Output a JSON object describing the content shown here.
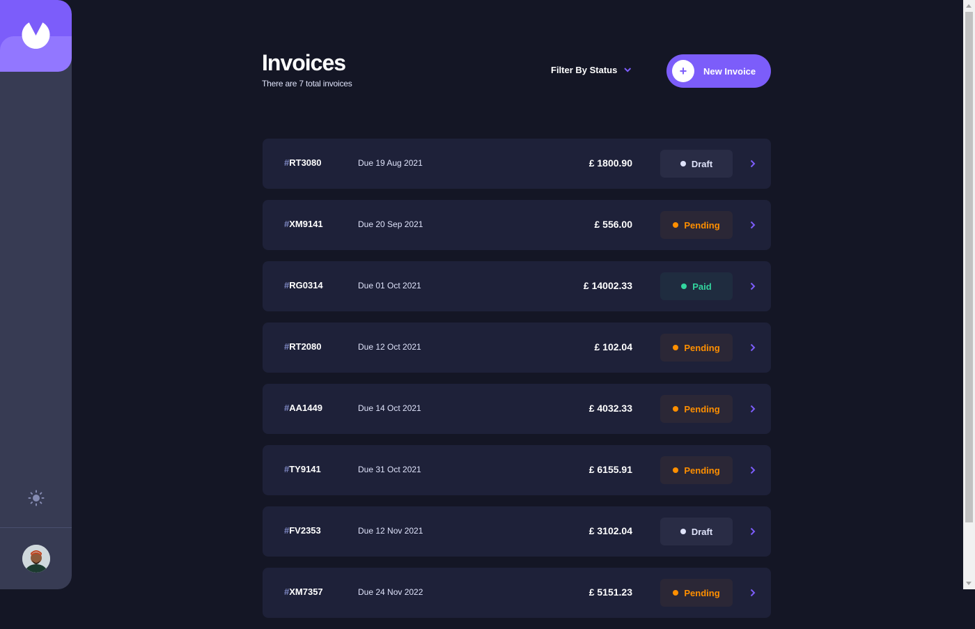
{
  "colors": {
    "accent": "#7c5dfa",
    "accent_light": "#9277ff",
    "background": "#141625",
    "card": "#1e2139",
    "sidebar": "#373b53",
    "paid": "#33d69f",
    "pending": "#ff8f00",
    "draft": "#dfe3fa"
  },
  "sidebar": {
    "logo_icon": "logo-icon",
    "theme_icon": "sun-icon",
    "avatar_icon": "avatar"
  },
  "header": {
    "title": "Invoices",
    "subtitle": "There are 7 total invoices",
    "filter_label": "Filter By Status",
    "filter_icon": "chevron-down-icon",
    "new_button_label": "New Invoice",
    "new_button_icon": "+"
  },
  "invoices": [
    {
      "hash": "#",
      "id": "RT3080",
      "due": "Due 19 Aug 2021",
      "client": "",
      "amount": "£ 1800.90",
      "status": "Draft",
      "status_class": "draft"
    },
    {
      "hash": "#",
      "id": "XM9141",
      "due": "Due 20 Sep 2021",
      "client": "",
      "amount": "£ 556.00",
      "status": "Pending",
      "status_class": "pending"
    },
    {
      "hash": "#",
      "id": "RG0314",
      "due": "Due 01 Oct 2021",
      "client": "",
      "amount": "£ 14002.33",
      "status": "Paid",
      "status_class": "paid"
    },
    {
      "hash": "#",
      "id": "RT2080",
      "due": "Due 12 Oct 2021",
      "client": "",
      "amount": "£ 102.04",
      "status": "Pending",
      "status_class": "pending"
    },
    {
      "hash": "#",
      "id": "AA1449",
      "due": "Due 14 Oct 2021",
      "client": "",
      "amount": "£ 4032.33",
      "status": "Pending",
      "status_class": "pending"
    },
    {
      "hash": "#",
      "id": "TY9141",
      "due": "Due 31 Oct 2021",
      "client": "",
      "amount": "£ 6155.91",
      "status": "Pending",
      "status_class": "pending"
    },
    {
      "hash": "#",
      "id": "FV2353",
      "due": "Due 12 Nov 2021",
      "client": "",
      "amount": "£ 3102.04",
      "status": "Draft",
      "status_class": "draft"
    },
    {
      "hash": "#",
      "id": "XM7357",
      "due": "Due 24 Nov 2022",
      "client": "",
      "amount": "£ 5151.23",
      "status": "Pending",
      "status_class": "pending"
    }
  ]
}
